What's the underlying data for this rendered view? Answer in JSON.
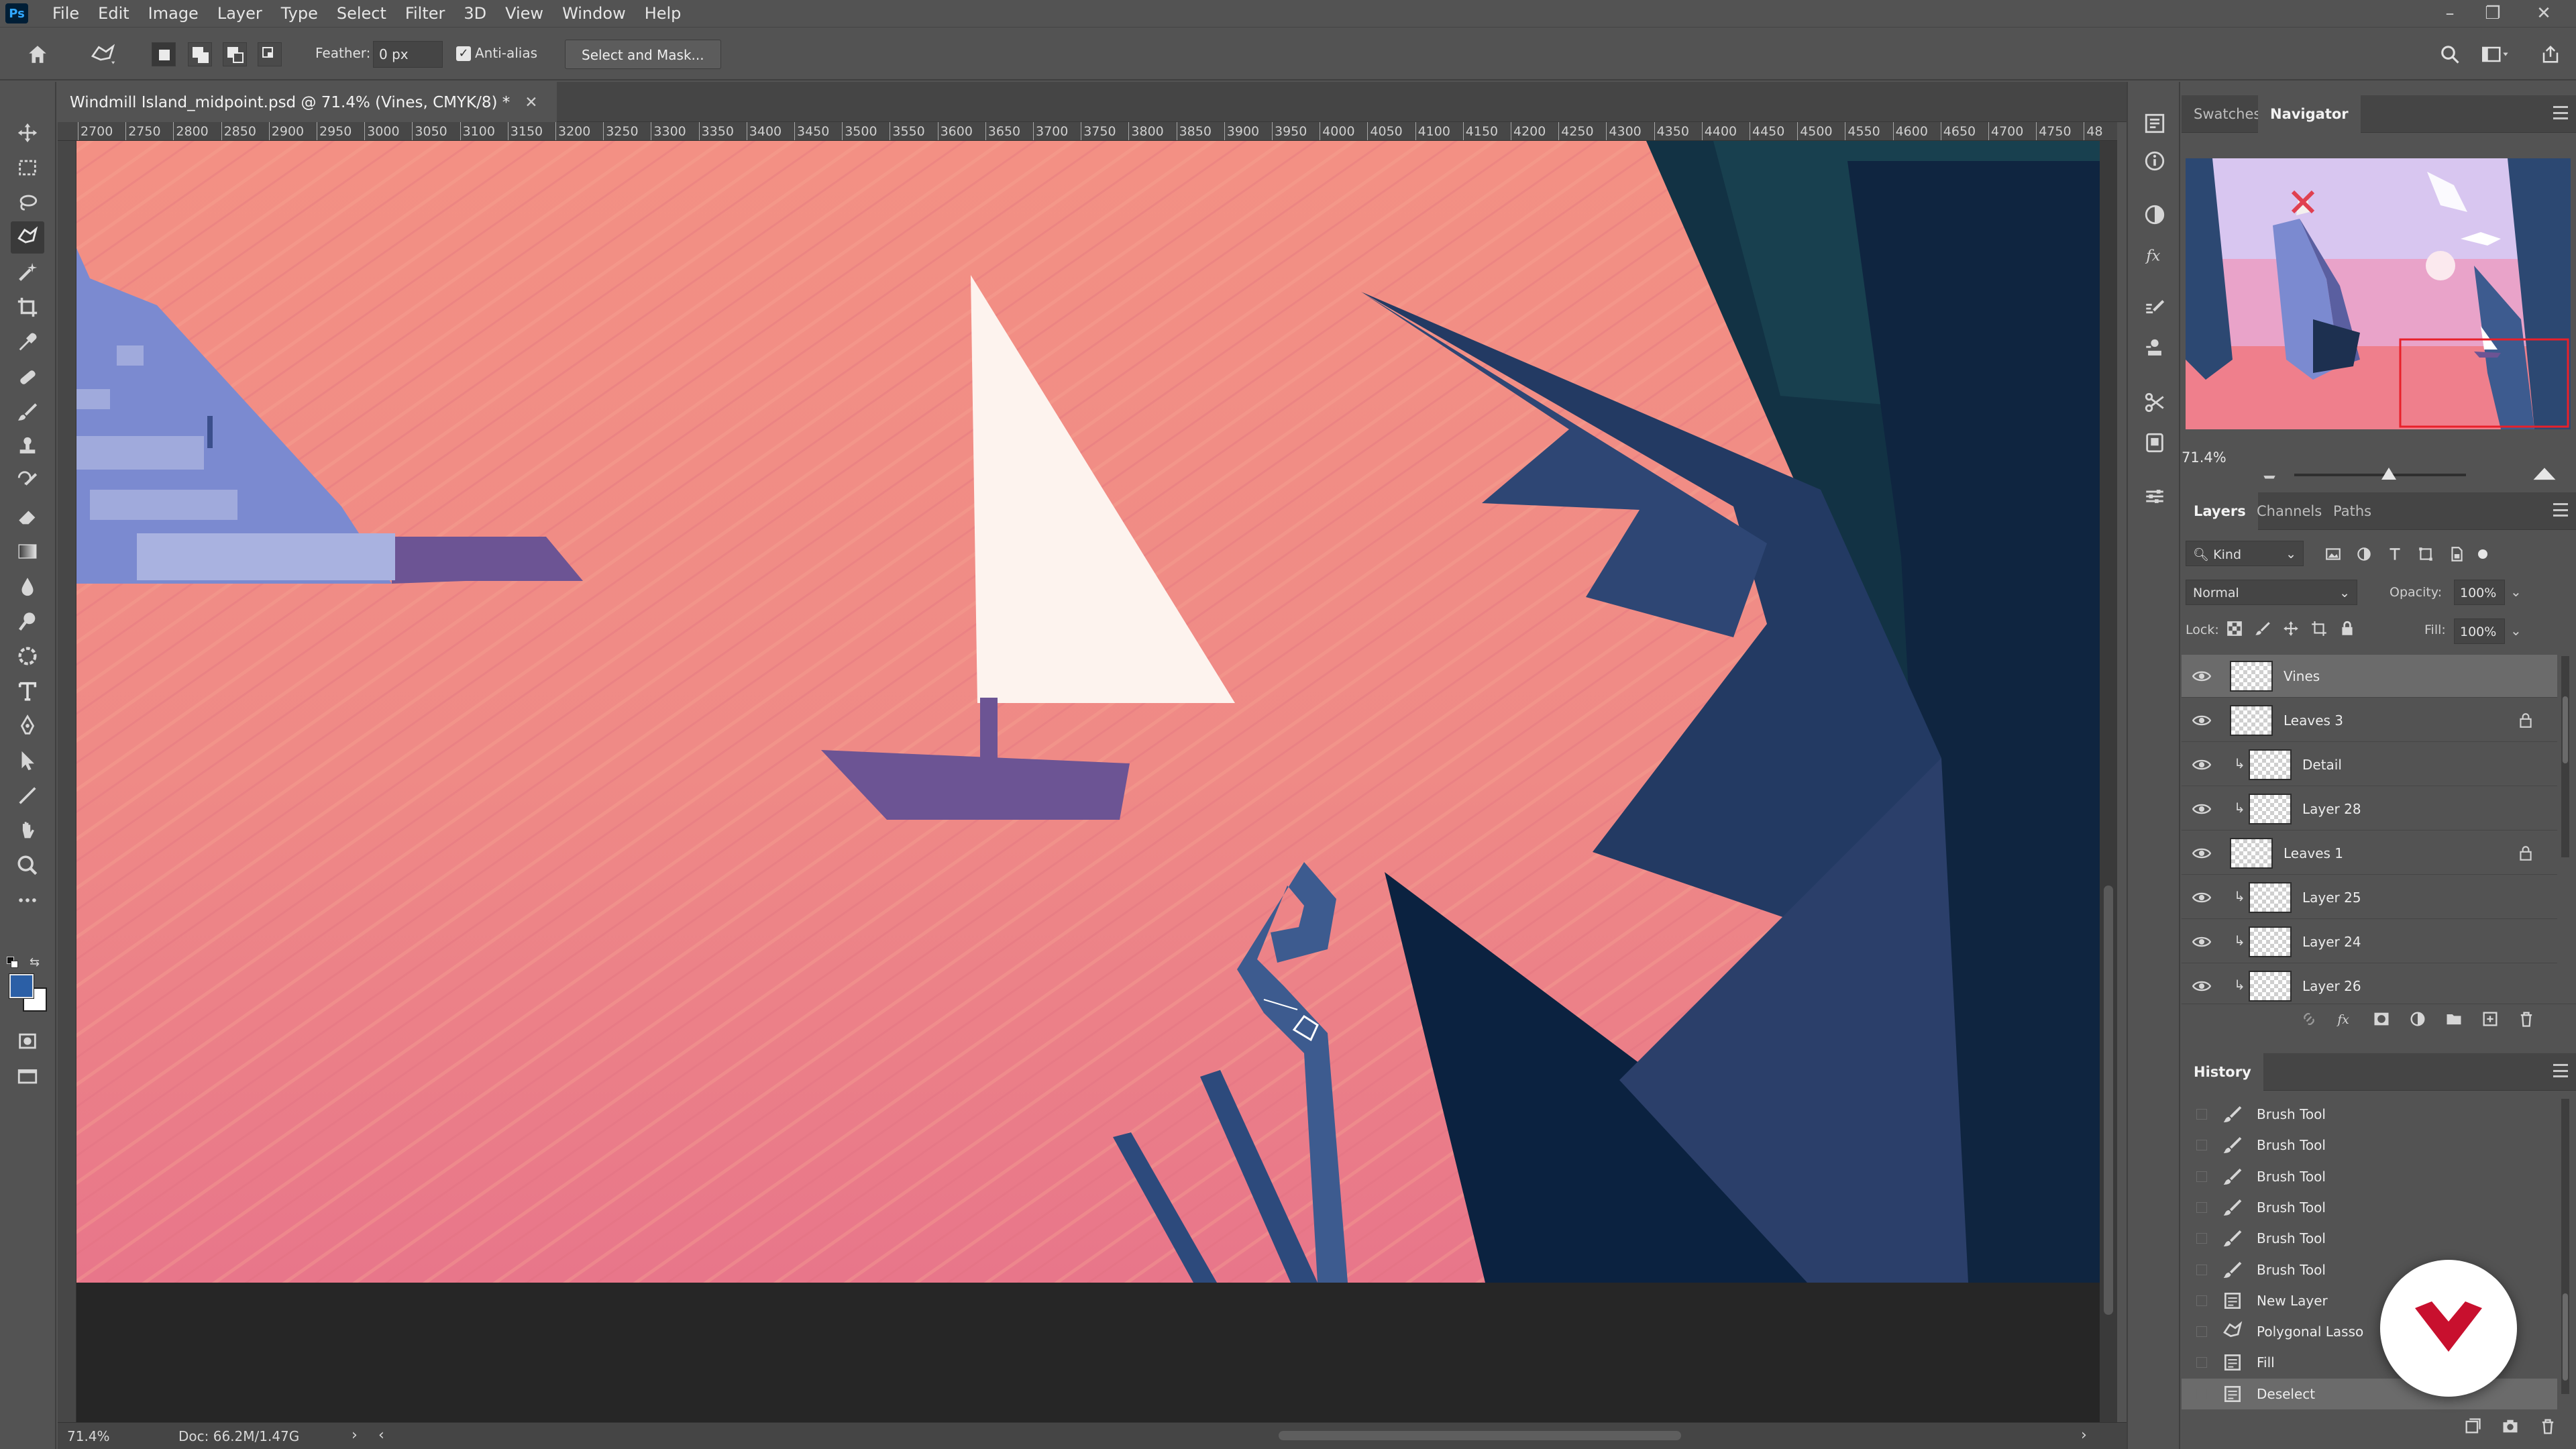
{
  "app": {
    "logo": "Ps"
  },
  "menu": [
    "File",
    "Edit",
    "Image",
    "Layer",
    "Type",
    "Select",
    "Filter",
    "3D",
    "View",
    "Window",
    "Help"
  ],
  "window_controls": {
    "minimize": "–",
    "restore": "❐",
    "close": "✕"
  },
  "options": {
    "feather_label": "Feather:",
    "feather_value": "0 px",
    "antialias_label": "Anti-alias",
    "antialias_checked": true,
    "select_mask_label": "Select and Mask..."
  },
  "document": {
    "tab_title": "Windmill Island_midpoint.psd @ 71.4% (Vines, CMYK/8) *",
    "ruler_ticks": [
      "2700",
      "2750",
      "2800",
      "2850",
      "2900",
      "2950",
      "3000",
      "3050",
      "3100",
      "3150",
      "3200",
      "3250",
      "3300",
      "3350",
      "3400",
      "3450",
      "3500",
      "3550",
      "3600",
      "3650",
      "3700",
      "3750",
      "3800",
      "3850",
      "3900",
      "3950",
      "4000",
      "4050",
      "4100",
      "4150",
      "4200",
      "4250",
      "4300",
      "4350",
      "4400",
      "4450",
      "4500",
      "4550",
      "4600",
      "4650",
      "4700",
      "4750",
      "48"
    ]
  },
  "status": {
    "zoom": "71.4%",
    "doc_size": "Doc: 66.2M/1.47G"
  },
  "navigator": {
    "tabs": [
      "Swatches",
      "Navigator"
    ],
    "active_tab": "Navigator",
    "zoom": "71.4%",
    "zoom_level": 0.55
  },
  "layers_panel": {
    "tabs": [
      "Layers",
      "Channels",
      "Paths"
    ],
    "active_tab": "Layers",
    "filter_kind": "Kind",
    "blend_mode": "Normal",
    "opacity_label": "Opacity:",
    "opacity_value": "100%",
    "lock_label": "Lock:",
    "fill_label": "Fill:",
    "fill_value": "100%",
    "layers": [
      {
        "name": "Vines",
        "selected": true,
        "clipped": false,
        "locked": false
      },
      {
        "name": "Leaves 3",
        "selected": false,
        "clipped": false,
        "locked": true
      },
      {
        "name": "Detail",
        "selected": false,
        "clipped": true,
        "locked": false
      },
      {
        "name": "Layer 28",
        "selected": false,
        "clipped": true,
        "locked": false
      },
      {
        "name": "Leaves 1",
        "selected": false,
        "clipped": false,
        "locked": true
      },
      {
        "name": "Layer 25",
        "selected": false,
        "clipped": true,
        "locked": false
      },
      {
        "name": "Layer 24",
        "selected": false,
        "clipped": true,
        "locked": false
      },
      {
        "name": "Layer 26",
        "selected": false,
        "clipped": true,
        "locked": false
      }
    ]
  },
  "history_panel": {
    "title": "History",
    "items": [
      {
        "name": "Brush Tool",
        "icon": "brush-icon"
      },
      {
        "name": "Brush Tool",
        "icon": "brush-icon"
      },
      {
        "name": "Brush Tool",
        "icon": "brush-icon"
      },
      {
        "name": "Brush Tool",
        "icon": "brush-icon"
      },
      {
        "name": "Brush Tool",
        "icon": "brush-icon"
      },
      {
        "name": "Brush Tool",
        "icon": "brush-icon"
      },
      {
        "name": "New Layer",
        "icon": "layer-icon"
      },
      {
        "name": "Polygonal Lasso",
        "icon": "polygonal-lasso-icon"
      },
      {
        "name": "Fill",
        "icon": "layer-icon"
      },
      {
        "name": "Deselect",
        "icon": "layer-icon"
      }
    ],
    "selected_index": 9
  },
  "colors": {
    "ui_bg": "#535353",
    "foreground": "#2b5fa6",
    "background": "#ffffff",
    "canvas_pink": "#ee8a8a",
    "navy": "#233a63",
    "purple": "#6c5494",
    "brand_red": "#c8102e"
  }
}
